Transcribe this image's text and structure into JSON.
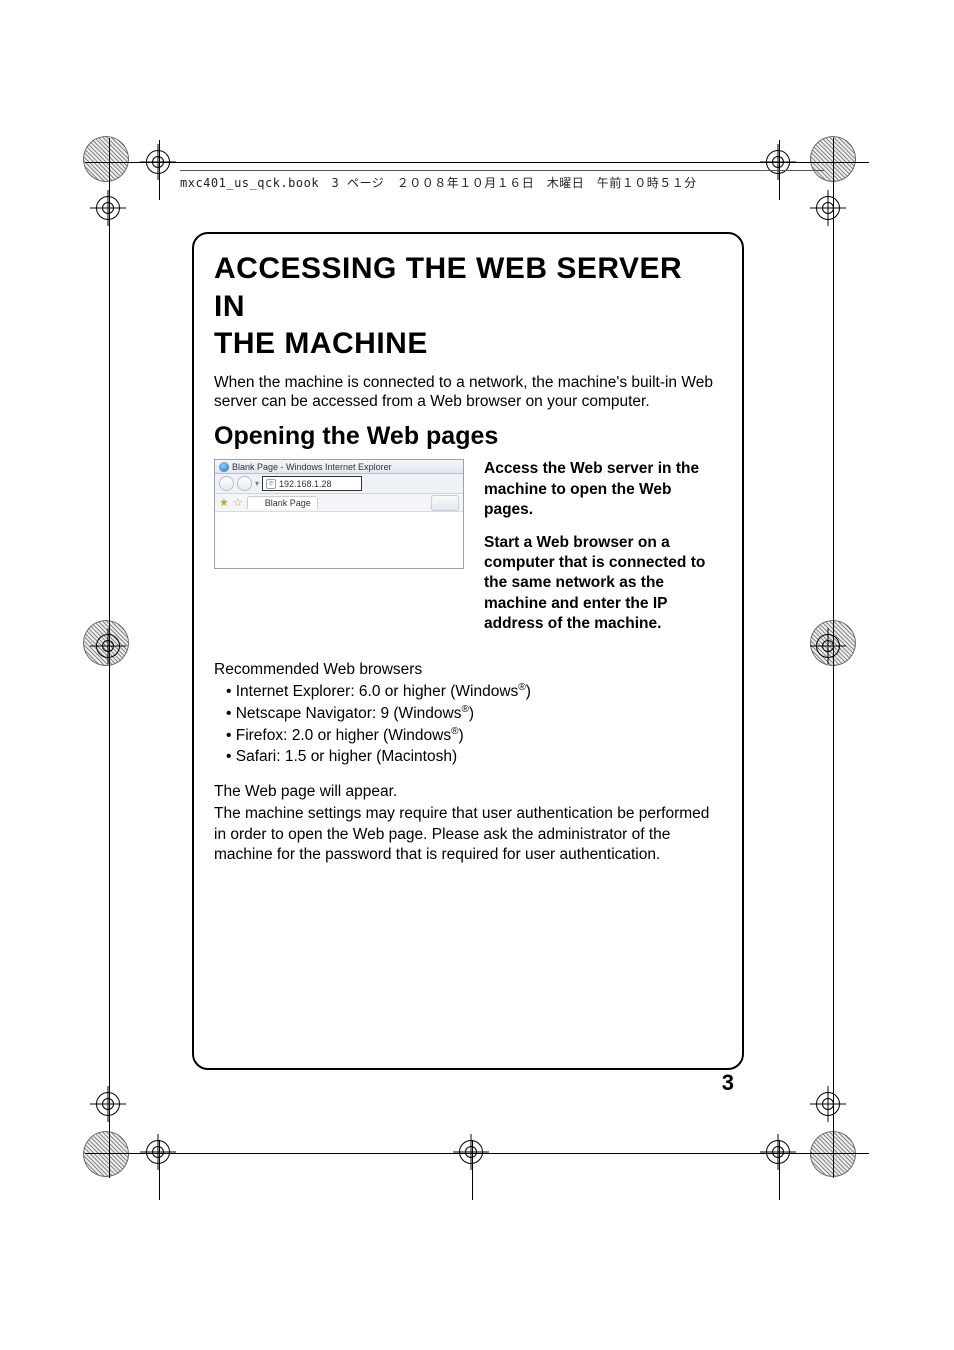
{
  "header_line": "mxc401_us_qck.book　3 ページ　２００８年１０月１６日　木曜日　午前１０時５１分",
  "title_line1": "ACCESSING THE WEB SERVER IN",
  "title_line2": "THE MACHINE",
  "intro": "When the machine is connected to a network, the machine's built-in Web server can be accessed from a Web browser on your computer.",
  "subhead": "Opening the Web pages",
  "browser": {
    "window_title": "Blank Page - Windows Internet Explorer",
    "address": "192.168.1.28",
    "tab_label": "Blank Page"
  },
  "right_p1": "Access the Web server in the machine to open the Web pages.",
  "right_p2": "Start a Web browser on a computer that is connected to the same network as the machine and enter the IP address of the machine.",
  "rec_head": "Recommended Web browsers",
  "bullets": {
    "b1a": "Internet Explorer: 6.0 or higher (Windows",
    "b1b": ")",
    "b2a": "Netscape Navigator: 9 (Windows",
    "b2b": ")",
    "b3a": "Firefox: 2.0 or higher (Windows",
    "b3b": ")",
    "b4": "Safari: 1.5 or higher (Macintosh)",
    "reg": "®"
  },
  "closing1": "The Web page will appear.",
  "closing2": "The machine settings may require that user authentication be performed in order to open the Web page. Please ask the administrator of the machine for the password that is required for user authentication.",
  "page_number": "3"
}
